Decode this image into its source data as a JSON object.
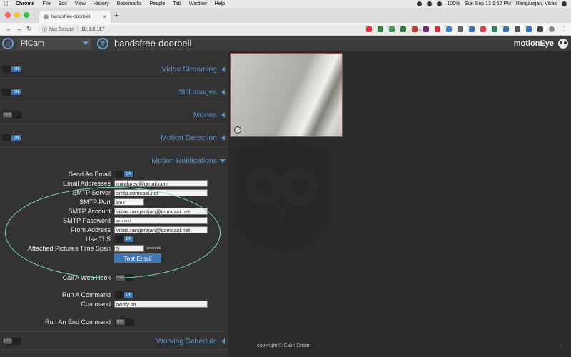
{
  "menubar": {
    "app": "Chrome",
    "items": [
      "File",
      "Edit",
      "View",
      "History",
      "Bookmarks",
      "People",
      "Tab",
      "Window",
      "Help"
    ],
    "battery": "100%",
    "clock": "Sun Sep 13  1:52 PM",
    "user": "Rangarajan, Vikas"
  },
  "browser": {
    "tab_title": "handsfree-doorbell",
    "not_secure": "Not Secure",
    "url": "10.0.0.117"
  },
  "header": {
    "camera": "PiCam",
    "camera_name": "handsfree-doorbell",
    "brand": "motionEye"
  },
  "sections": {
    "video_streaming": {
      "title": "Video Streaming",
      "toggle": "ON"
    },
    "still_images": {
      "title": "Still Images",
      "toggle": "ON"
    },
    "movies": {
      "title": "Movies",
      "toggle": "OFF"
    },
    "motion_detection": {
      "title": "Motion Detection",
      "toggle": "ON"
    },
    "motion_notifications": {
      "title": "Motion Notifications"
    },
    "working_schedule": {
      "title": "Working Schedule",
      "toggle": "OFF"
    }
  },
  "notifications": {
    "send_email_label": "Send An Email",
    "send_email_toggle": "ON",
    "email_addresses_label": "Email Addresses",
    "email_addresses": "mindgrep@gmail.com",
    "smtp_server_label": "SMTP Server",
    "smtp_server": "smtp.comcast.net",
    "smtp_port_label": "SMTP Port",
    "smtp_port": "587",
    "smtp_account_label": "SMTP Account",
    "smtp_account": "vikas.rangarajan@comcast.net",
    "smtp_password_label": "SMTP Password",
    "smtp_password": "••••••••",
    "from_address_label": "From Address",
    "from_address": "vikas.rangarajan@comcast.net",
    "use_tls_label": "Use TLS",
    "use_tls_toggle": "ON",
    "pictures_span_label": "Attached Pictures Time Span",
    "pictures_span": "5",
    "pictures_span_units": "seconds",
    "test_email": "Test Email",
    "web_hook_label": "Call A Web Hook",
    "web_hook_toggle": "OFF",
    "run_command_label": "Run A Command",
    "run_command_toggle": "ON",
    "command_label": "Command",
    "command": "notify.sh",
    "end_command_label": "Run An End Command",
    "end_command_toggle": "OFF"
  },
  "footer": {
    "copyright": "copyright © Calin Crisan"
  },
  "colors": {
    "accent": "#5b93cc",
    "toggle_on": "#3d77b6",
    "panel": "#333333",
    "annotation": "#7ad4c8"
  }
}
